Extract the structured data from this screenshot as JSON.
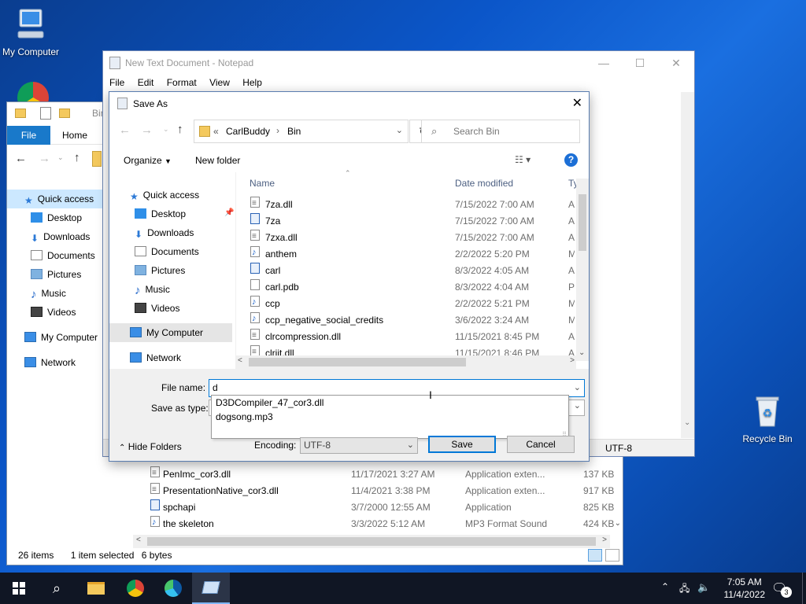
{
  "desktop": {
    "icons": [
      {
        "label": "My Computer",
        "icon": "computer-icon"
      },
      {
        "label": "Recycle Bin",
        "icon": "recycle-bin-icon"
      }
    ],
    "wallpaper_color": "#0b56c9"
  },
  "explorer": {
    "title_crumb": "Bin",
    "tabs": {
      "file": "File",
      "home": "Home"
    },
    "nav": {
      "quick_access": "Quick access",
      "desktop": "Desktop",
      "downloads": "Downloads",
      "documents": "Documents",
      "pictures": "Pictures",
      "music": "Music",
      "videos": "Videos",
      "my_computer": "My Computer",
      "network": "Network"
    },
    "rows": [
      {
        "name": "PenImc_cor3.dll",
        "date": "11/17/2021 3:27 AM",
        "type": "Application exten...",
        "size": "137 KB",
        "icon": "dll-icon"
      },
      {
        "name": "PresentationNative_cor3.dll",
        "date": "11/4/2021 3:38 PM",
        "type": "Application exten...",
        "size": "917 KB",
        "icon": "dll-icon"
      },
      {
        "name": "spchapi",
        "date": "3/7/2000 12:55 AM",
        "type": "Application",
        "size": "825 KB",
        "icon": "app-icon"
      },
      {
        "name": "the skeleton",
        "date": "3/3/2022 5:12 AM",
        "type": "MP3 Format Sound",
        "size": "424 KB",
        "icon": "music-file-icon"
      }
    ],
    "status": {
      "count": "26 items",
      "selected": "1 item selected",
      "size": "6 bytes"
    }
  },
  "notepad": {
    "title": "New Text Document - Notepad",
    "menu": [
      "File",
      "Edit",
      "Format",
      "View",
      "Help"
    ],
    "status_encoding": "UTF-8"
  },
  "save_as": {
    "title": "Save As",
    "address": {
      "prefix": "«",
      "parent": "CarlBuddy",
      "current": "Bin"
    },
    "search_placeholder": "Search Bin",
    "toolbar": {
      "organize": "Organize",
      "new_folder": "New folder"
    },
    "nav": {
      "quick_access": "Quick access",
      "desktop": "Desktop",
      "downloads": "Downloads",
      "documents": "Documents",
      "pictures": "Pictures",
      "music": "Music",
      "videos": "Videos",
      "my_computer": "My Computer",
      "network": "Network"
    },
    "columns": {
      "name": "Name",
      "date": "Date modified",
      "type": "Ty"
    },
    "files": [
      {
        "name": "7za.dll",
        "date": "7/15/2022 7:00 AM",
        "type": "Ap",
        "icon": "dll-icon"
      },
      {
        "name": "7za",
        "date": "7/15/2022 7:00 AM",
        "type": "Ap",
        "icon": "app-icon"
      },
      {
        "name": "7zxa.dll",
        "date": "7/15/2022 7:00 AM",
        "type": "Ap",
        "icon": "dll-icon"
      },
      {
        "name": "anthem",
        "date": "2/2/2022 5:20 PM",
        "type": "M",
        "icon": "music-file-icon"
      },
      {
        "name": "carl",
        "date": "8/3/2022 4:05 AM",
        "type": "Ap",
        "icon": "app-icon"
      },
      {
        "name": "carl.pdb",
        "date": "8/3/2022 4:04 AM",
        "type": "PI",
        "icon": "file-icon"
      },
      {
        "name": "ccp",
        "date": "2/2/2022 5:21 PM",
        "type": "M",
        "icon": "music-file-icon"
      },
      {
        "name": "ccp_negative_social_credits",
        "date": "3/6/2022 3:24 AM",
        "type": "M",
        "icon": "music-file-icon"
      },
      {
        "name": "clrcompression.dll",
        "date": "11/15/2021 8:45 PM",
        "type": "Ap",
        "icon": "dll-icon"
      },
      {
        "name": "clrjit.dll",
        "date": "11/15/2021 8:46 PM",
        "type": "Ap",
        "icon": "dll-icon"
      }
    ],
    "file_name_label": "File name:",
    "file_name_value": "d",
    "save_as_type_label": "Save as type:",
    "autocomplete": [
      "D3DCompiler_47_cor3.dll",
      "dogsong.mp3"
    ],
    "hide_folders": "Hide Folders",
    "encoding_label": "Encoding:",
    "encoding_value": "UTF-8",
    "save_button": "Save",
    "cancel_button": "Cancel"
  },
  "taskbar": {
    "time": "7:05 AM",
    "date": "11/4/2022",
    "notification_count": "3"
  }
}
